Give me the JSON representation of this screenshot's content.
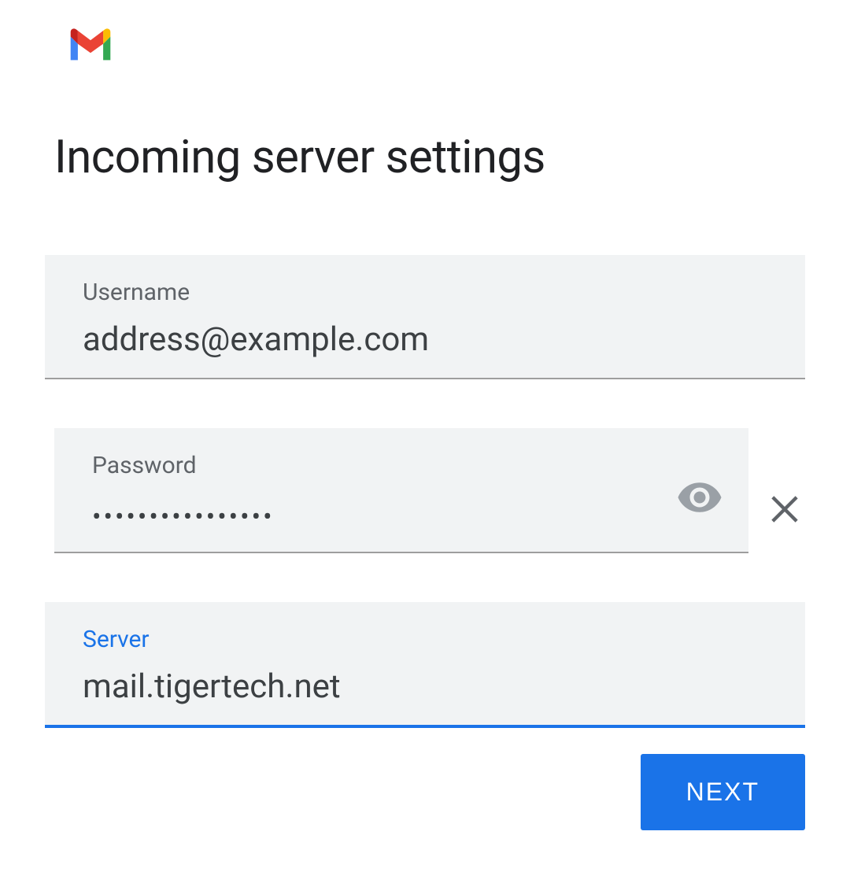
{
  "page_title": "Incoming server settings",
  "fields": {
    "username": {
      "label": "Username",
      "value": "address@example.com"
    },
    "password": {
      "label": "Password",
      "value": "••••••••••••••••"
    },
    "server": {
      "label": "Server",
      "value": "mail.tigertech.net"
    }
  },
  "buttons": {
    "next": "NEXT"
  }
}
